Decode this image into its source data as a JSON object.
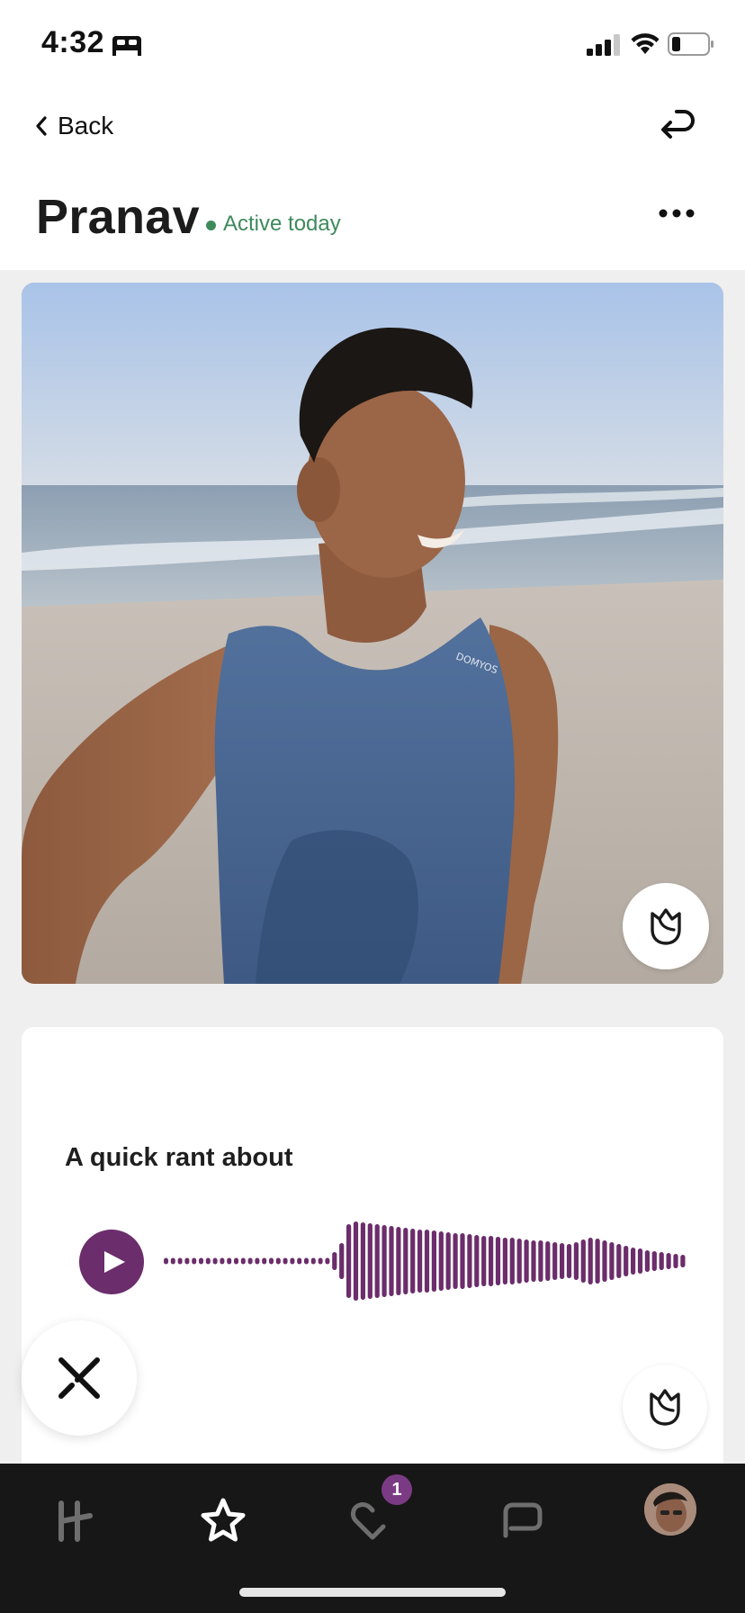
{
  "status_bar": {
    "time": "4:32",
    "icons": [
      "sleep-icon",
      "signal-icon",
      "wifi-icon",
      "battery-icon"
    ]
  },
  "nav": {
    "back_label": "Back",
    "undo_icon": "undo-icon"
  },
  "profile": {
    "name": "Pranav",
    "activity": "Active today",
    "activity_color": "#3e8a5c"
  },
  "photo": {
    "shirt_text": "DOMYOS"
  },
  "voice_prompt": {
    "prompt": "A quick rant about",
    "accent_color": "#6b2d6b"
  },
  "tab_bar": {
    "items": [
      "home-tab",
      "standouts-tab",
      "likes-tab",
      "messages-tab",
      "profile-tab"
    ],
    "likes_badge": "1",
    "active": "standouts-tab"
  }
}
